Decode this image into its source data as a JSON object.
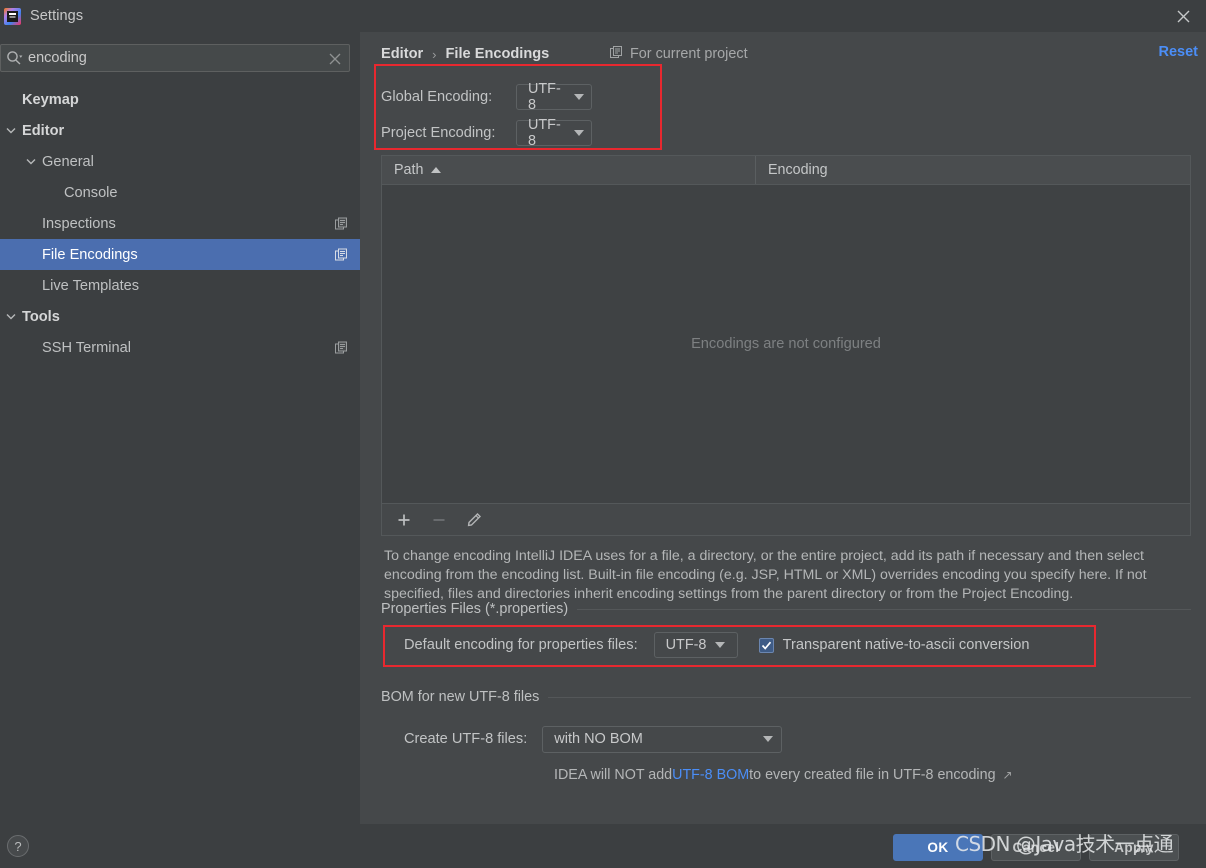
{
  "window": {
    "title": "Settings",
    "logo_icon": "intellij-idea-logo",
    "close_icon": "close-icon"
  },
  "search": {
    "value": "encoding",
    "placeholder": "",
    "icon": "search-icon",
    "clear_icon": "close-icon"
  },
  "sidebar": {
    "items": [
      {
        "label": "Keymap",
        "level": 0,
        "bold": true,
        "arrow": "none",
        "selected": false,
        "project_icon": false
      },
      {
        "label": "Editor",
        "level": 0,
        "bold": true,
        "arrow": "chevron-down",
        "selected": false,
        "project_icon": false
      },
      {
        "label": "General",
        "level": 1,
        "bold": false,
        "arrow": "chevron-down",
        "selected": false,
        "project_icon": false
      },
      {
        "label": "Console",
        "level": 3,
        "bold": false,
        "arrow": "none",
        "selected": false,
        "project_icon": false
      },
      {
        "label": "Inspections",
        "level": 2,
        "bold": false,
        "arrow": "none",
        "selected": false,
        "project_icon": true
      },
      {
        "label": "File Encodings",
        "level": 2,
        "bold": false,
        "arrow": "none",
        "selected": true,
        "project_icon": true
      },
      {
        "label": "Live Templates",
        "level": 2,
        "bold": false,
        "arrow": "none",
        "selected": false,
        "project_icon": false
      },
      {
        "label": "Tools",
        "level": 0,
        "bold": true,
        "arrow": "chevron-down",
        "selected": false,
        "project_icon": false
      },
      {
        "label": "SSH Terminal",
        "level": 2,
        "bold": false,
        "arrow": "none",
        "selected": false,
        "project_icon": true
      }
    ]
  },
  "main": {
    "breadcrumb": {
      "root": "Editor",
      "separator": "›",
      "current": "File Encodings"
    },
    "for_current_project": {
      "label": "For current project",
      "icon": "project-scope-icon"
    },
    "reset_label": "Reset",
    "global_encoding": {
      "label": "Global Encoding:",
      "value": "UTF-8"
    },
    "project_encoding": {
      "label": "Project Encoding:",
      "value": "UTF-8"
    },
    "table": {
      "columns": [
        "Path",
        "Encoding"
      ],
      "sort_column": "Path",
      "sort_direction": "ascending",
      "rows": [],
      "empty_message": "Encodings are not configured"
    },
    "table_toolbar": [
      {
        "name": "add-button",
        "icon": "plus-icon",
        "enabled": true
      },
      {
        "name": "remove-button",
        "icon": "minus-icon",
        "enabled": false
      },
      {
        "name": "edit-button",
        "icon": "pencil-icon",
        "enabled": true
      }
    ],
    "description": "To change encoding IntelliJ IDEA uses for a file, a directory, or the entire project, add its path if necessary and then select encoding from the encoding list. Built-in file encoding (e.g. JSP, HTML or XML) overrides encoding you specify here. If not specified, files and directories inherit encoding settings from the parent directory or from the Project Encoding.",
    "properties_section": {
      "title": "Properties Files (*.properties)",
      "default_encoding_label": "Default encoding for properties files:",
      "default_encoding_value": "UTF-8",
      "transparent_label": "Transparent native-to-ascii conversion",
      "transparent_checked": true
    },
    "bom_section": {
      "title": "BOM for new UTF-8 files",
      "create_label": "Create UTF-8 files:",
      "create_value": "with NO BOM",
      "note_prefix": "IDEA will NOT add ",
      "note_link": "UTF-8 BOM",
      "note_suffix": " to every created file in UTF-8 encoding",
      "external_link_icon": "↗"
    }
  },
  "footer": {
    "help_label": "?",
    "ok_label": "OK",
    "cancel_label": "Cancel",
    "apply_label": "Apply"
  },
  "watermark": {
    "text": "CSDN @Java技术一点通"
  },
  "colors": {
    "accent": "#4b6eaf",
    "link": "#4b8ef7",
    "annotation": "#e8282f",
    "background": "#3c3f41",
    "panel": "#45484a"
  }
}
